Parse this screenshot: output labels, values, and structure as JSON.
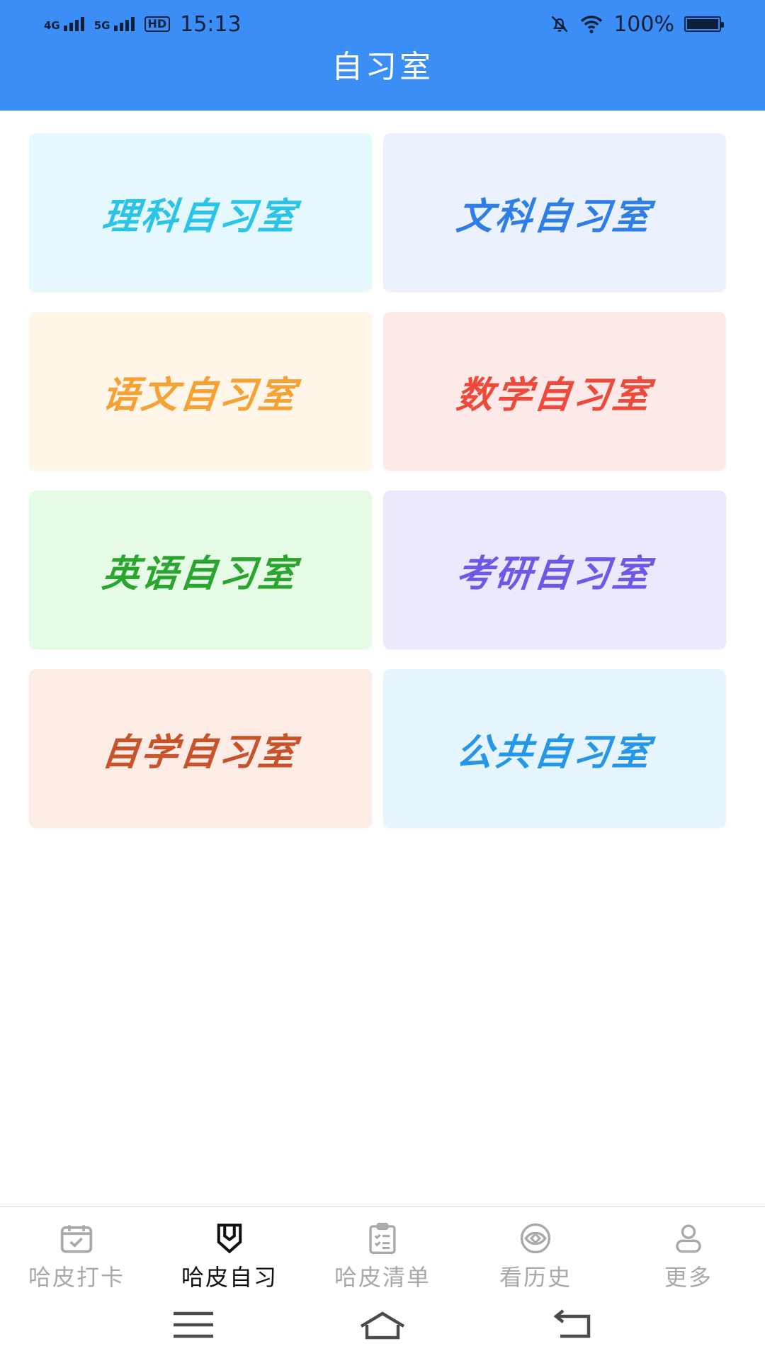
{
  "status_bar": {
    "time": "15:13",
    "network_1": "4G",
    "network_2": "5G",
    "hd_badge": "HD",
    "battery": "100%"
  },
  "header": {
    "title": "自习室"
  },
  "rooms": [
    {
      "label": "理科自习室",
      "text_color": "#2bc3e8",
      "bg_color": "#e4f8fd"
    },
    {
      "label": "文科自习室",
      "text_color": "#2f7ee8",
      "bg_color": "#ecf2fd"
    },
    {
      "label": "语文自习室",
      "text_color": "#f5a134",
      "bg_color": "#fff5e8"
    },
    {
      "label": "数学自习室",
      "text_color": "#ee4a3c",
      "bg_color": "#fde9e7"
    },
    {
      "label": "英语自习室",
      "text_color": "#2aa52f",
      "bg_color": "#e6fbe6"
    },
    {
      "label": "考研自习室",
      "text_color": "#7157e6",
      "bg_color": "#ece9fd"
    },
    {
      "label": "自学自习室",
      "text_color": "#c8522a",
      "bg_color": "#fdebe6"
    },
    {
      "label": "公共自习室",
      "text_color": "#2596e8",
      "bg_color": "#e5f4fd"
    }
  ],
  "tabs": [
    {
      "label": "哈皮打卡",
      "icon": "calendar-check-icon",
      "active": false
    },
    {
      "label": "哈皮自习",
      "icon": "shield-book-icon",
      "active": true
    },
    {
      "label": "哈皮清单",
      "icon": "clipboard-list-icon",
      "active": false
    },
    {
      "label": "看历史",
      "icon": "eye-icon",
      "active": false
    },
    {
      "label": "更多",
      "icon": "user-icon",
      "active": false
    }
  ],
  "nav": {
    "menu": "menu-icon",
    "home": "home-icon",
    "back": "back-icon"
  }
}
